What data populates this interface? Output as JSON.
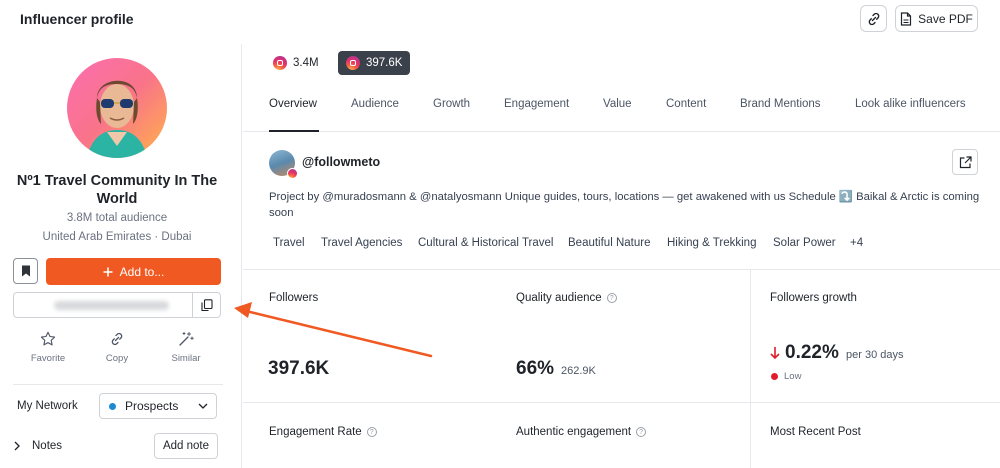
{
  "header": {
    "title": "Influencer profile",
    "save_pdf_label": "Save PDF"
  },
  "profile": {
    "name": "Nº1 Travel Community In The World",
    "audience": "3.8M total audience",
    "location": "United Arab Emirates · Dubai",
    "add_label": "Add to...",
    "actions": [
      {
        "label": "Favorite",
        "icon": "star-icon"
      },
      {
        "label": "Copy",
        "icon": "link-icon"
      },
      {
        "label": "Similar",
        "icon": "magic-wand-icon"
      }
    ],
    "network_label": "My Network",
    "network_value": "Prospects",
    "notes_label": "Notes",
    "add_note_label": "Add note"
  },
  "platforms": [
    {
      "count": "3.4M",
      "icon": "instagram-icon"
    },
    {
      "count": "397.6K",
      "icon": "instagram-icon",
      "selected": true
    }
  ],
  "tabs": [
    "Overview",
    "Audience",
    "Growth",
    "Engagement",
    "Value",
    "Content",
    "Brand Mentions",
    "Look alike influencers"
  ],
  "account": {
    "handle": "@followmeto",
    "bio": "Project by @muradosmann & @natalyosmann Unique guides, tours, locations — get awakened with us Schedule ⤵️ Baikal & Arctic is coming soon",
    "tags": [
      "Travel",
      "Travel Agencies",
      "Cultural & Historical Travel",
      "Beautiful Nature",
      "Hiking & Trekking",
      "Solar Power",
      "+4"
    ]
  },
  "stats": {
    "followers": {
      "label": "Followers",
      "value": "397.6K"
    },
    "quality": {
      "label": "Quality audience",
      "value": "66%",
      "sub": "262.9K"
    },
    "growth": {
      "label": "Followers growth",
      "value": "0.22%",
      "sub": "per 30 days",
      "level": "Low"
    },
    "engagement_rate": {
      "label": "Engagement Rate"
    },
    "authentic": {
      "label": "Authentic engagement"
    },
    "recent_post": {
      "label": "Most Recent Post"
    }
  },
  "colors": {
    "accent": "#f05a22",
    "pill_dark": "#3b414a",
    "low": "#e11d2a",
    "network_dot": "#1b8ad0"
  }
}
